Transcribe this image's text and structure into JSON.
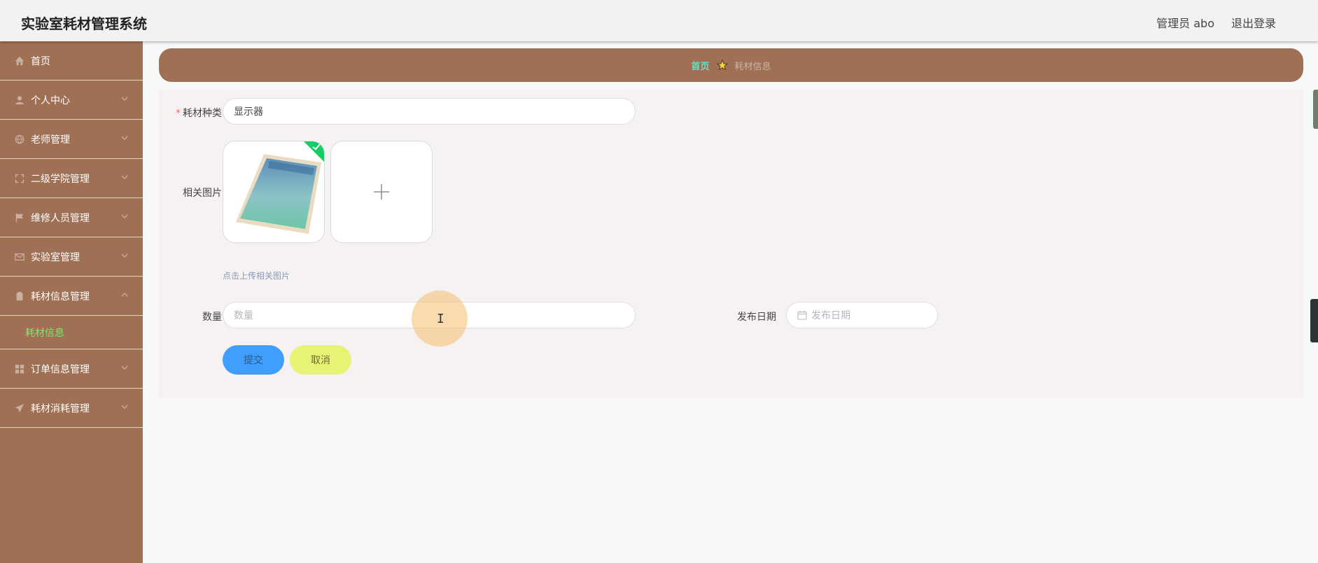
{
  "app": {
    "title": "实验室耗材管理系统",
    "user_label": "管理员 abo",
    "logout_label": "退出登录"
  },
  "sidebar": {
    "items": [
      {
        "label": "首页",
        "icon": "home-icon"
      },
      {
        "label": "个人中心",
        "icon": "user-icon"
      },
      {
        "label": "老师管理",
        "icon": "globe-icon"
      },
      {
        "label": "二级学院管理",
        "icon": "expand-icon"
      },
      {
        "label": "维修人员管理",
        "icon": "flag-icon"
      },
      {
        "label": "实验室管理",
        "icon": "mail-icon"
      },
      {
        "label": "耗材信息管理",
        "icon": "clipboard-icon"
      },
      {
        "label": "订单信息管理",
        "icon": "grid-icon"
      },
      {
        "label": "耗材消耗管理",
        "icon": "send-icon"
      }
    ],
    "active_sub": "耗材信息"
  },
  "breadcrumb": {
    "home": "首页",
    "current": "耗材信息"
  },
  "form": {
    "category_label": "耗材种类",
    "category_value": "显示器",
    "image_label": "相关图片",
    "upload_tip": "点击上传相关图片",
    "quantity_label": "数量",
    "quantity_placeholder": "数量",
    "date_label": "发布日期",
    "date_placeholder": "发布日期",
    "submit_label": "提交",
    "cancel_label": "取消"
  },
  "colors": {
    "sidebar_bg": "#a07055",
    "active_sub": "#7bea6d",
    "breadcrumb_home": "#66e0c8",
    "submit": "#409eff",
    "cancel": "#e8f274"
  }
}
